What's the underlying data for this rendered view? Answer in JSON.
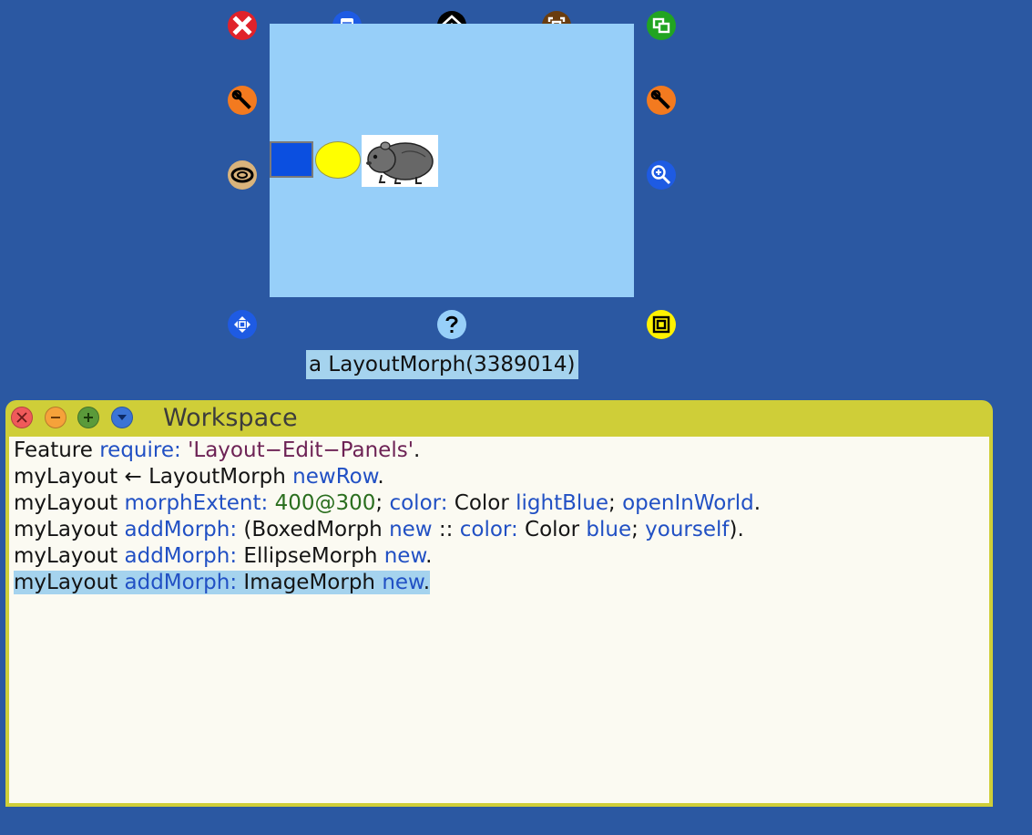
{
  "colors": {
    "desktop": "#2b58a2",
    "layout_morph": "#97cff9",
    "boxed_morph": "#0b4fe0",
    "ellipse_morph": "#ffff00",
    "label_bg": "#a5d3ee",
    "window_frame": "#cfce38",
    "editor_bg": "#fbfaf2",
    "selection": "#a5d3ee"
  },
  "halo": {
    "handles": [
      {
        "name": "dismiss",
        "icon": "close-icon",
        "color": "#e0222a"
      },
      {
        "name": "menu",
        "icon": "menu-icon",
        "color": "#1e5be3"
      },
      {
        "name": "grab",
        "icon": "grab-icon",
        "color": "#000000"
      },
      {
        "name": "drag",
        "icon": "drag-icon",
        "color": "#6a3d0f"
      },
      {
        "name": "duplicate",
        "icon": "duplicate-icon",
        "color": "#21a421"
      },
      {
        "name": "debug",
        "icon": "wrench-icon",
        "color": "#f37a1f"
      },
      {
        "name": "debug-right",
        "icon": "wrench-icon",
        "color": "#f37a1f"
      },
      {
        "name": "collapse",
        "icon": "collapse-icon",
        "color": "#d9b37b"
      },
      {
        "name": "scale",
        "icon": "zoom-in-icon",
        "color": "#1e5be3"
      },
      {
        "name": "rotate",
        "icon": "rotate-icon",
        "color": "#1e5be3"
      },
      {
        "name": "help",
        "icon": "help-icon",
        "color": "#97cff9"
      },
      {
        "name": "resize",
        "icon": "resize-icon",
        "color": "#fff200"
      }
    ],
    "label": "a LayoutMorph(3389014)"
  },
  "workspace": {
    "title": "Workspace",
    "buttons": [
      {
        "name": "close",
        "color": "#f05a5a"
      },
      {
        "name": "collapse",
        "color": "#f6a23a"
      },
      {
        "name": "expand",
        "color": "#5a9a3a"
      },
      {
        "name": "menu",
        "color": "#3b74d6"
      }
    ],
    "lines": [
      [
        {
          "t": "Feature ",
          "c": "plain"
        },
        {
          "t": "require:",
          "c": "kw"
        },
        {
          "t": " ",
          "c": "plain"
        },
        {
          "t": "'Layout−Edit−Panels'",
          "c": "str"
        },
        {
          "t": ".",
          "c": "plain"
        }
      ],
      [
        {
          "t": "myLayout ← LayoutMorph ",
          "c": "plain"
        },
        {
          "t": "newRow",
          "c": "kw"
        },
        {
          "t": ".",
          "c": "plain"
        }
      ],
      [
        {
          "t": "myLayout ",
          "c": "plain"
        },
        {
          "t": "morphExtent:",
          "c": "kw"
        },
        {
          "t": " ",
          "c": "plain"
        },
        {
          "t": "400@300",
          "c": "num"
        },
        {
          "t": "; ",
          "c": "plain"
        },
        {
          "t": "color:",
          "c": "kw"
        },
        {
          "t": " Color ",
          "c": "plain"
        },
        {
          "t": "lightBlue",
          "c": "kw"
        },
        {
          "t": "; ",
          "c": "plain"
        },
        {
          "t": "openInWorld",
          "c": "kw"
        },
        {
          "t": ".",
          "c": "plain"
        }
      ],
      [
        {
          "t": "myLayout ",
          "c": "plain"
        },
        {
          "t": "addMorph:",
          "c": "kw"
        },
        {
          "t": " (BoxedMorph ",
          "c": "plain"
        },
        {
          "t": "new",
          "c": "kw"
        },
        {
          "t": " :: ",
          "c": "plain"
        },
        {
          "t": "color:",
          "c": "kw"
        },
        {
          "t": " Color ",
          "c": "plain"
        },
        {
          "t": "blue",
          "c": "kw"
        },
        {
          "t": "; ",
          "c": "plain"
        },
        {
          "t": "yourself",
          "c": "kw"
        },
        {
          "t": ").",
          "c": "plain"
        }
      ],
      [
        {
          "t": "myLayout ",
          "c": "plain"
        },
        {
          "t": "addMorph:",
          "c": "kw"
        },
        {
          "t": " EllipseMorph ",
          "c": "plain"
        },
        {
          "t": "new",
          "c": "kw"
        },
        {
          "t": ".",
          "c": "plain"
        }
      ],
      [
        {
          "t": "myLayout ",
          "c": "plain"
        },
        {
          "t": "addMorph:",
          "c": "kw"
        },
        {
          "t": " ImageMorph ",
          "c": "plain"
        },
        {
          "t": "new",
          "c": "kw"
        },
        {
          "t": ".",
          "c": "plain"
        }
      ]
    ],
    "selected_line": 5
  }
}
